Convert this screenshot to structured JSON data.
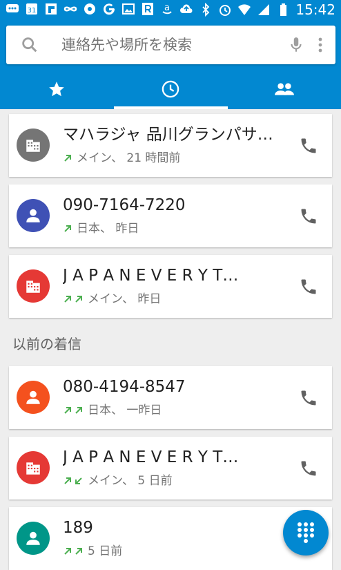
{
  "status_bar": {
    "time": "15:42",
    "icons_left": [
      "chat-icon",
      "calendar-31-icon",
      "flipboard-icon",
      "infinity-icon",
      "at-icon",
      "google-g-icon",
      "image-icon",
      "r-icon",
      "amazon-icon",
      "cloud-upload-icon"
    ],
    "icons_right": [
      "bluetooth-icon",
      "alarm-icon",
      "wifi-icon",
      "signal-icon",
      "battery-icon"
    ],
    "calendar_day": "31"
  },
  "search": {
    "placeholder": "連絡先や場所を検索"
  },
  "tabs": [
    {
      "name": "favorites",
      "icon": "star-icon",
      "selected": false
    },
    {
      "name": "recents",
      "icon": "clock-icon",
      "selected": true
    },
    {
      "name": "contacts",
      "icon": "people-icon",
      "selected": false
    }
  ],
  "section_header": "以前の着信",
  "recents": [
    {
      "name": "マハラジャ 品川グランパサ…",
      "detail": "メイン、 21 時間前",
      "avatar_color": "#757575",
      "avatar_icon": "business-icon",
      "call_types": [
        "outgoing"
      ]
    },
    {
      "name": "090-7164-7220",
      "detail": "日本、 昨日",
      "avatar_color": "#3f51b5",
      "avatar_icon": "person-icon",
      "call_types": [
        "outgoing"
      ]
    },
    {
      "name": "J A P A N  E V E R Y  T…",
      "detail": "メイン、 昨日",
      "avatar_color": "#e53935",
      "avatar_icon": "business-icon",
      "call_types": [
        "outgoing",
        "outgoing"
      ]
    },
    {
      "name": "080-4194-8547",
      "detail": "日本、 一昨日",
      "avatar_color": "#f4511e",
      "avatar_icon": "person-icon",
      "call_types": [
        "outgoing",
        "outgoing"
      ]
    },
    {
      "name": "J A P A N  E V E R Y  T…",
      "detail": "メイン、 5 日前",
      "avatar_color": "#e53935",
      "avatar_icon": "business-icon",
      "call_types": [
        "outgoing",
        "incoming"
      ]
    },
    {
      "name": "189",
      "detail": "5 日前",
      "avatar_color": "#009688",
      "avatar_icon": "person-icon",
      "call_types": [
        "outgoing",
        "outgoing"
      ]
    }
  ],
  "colors": {
    "primary": "#0288d1",
    "call_green": "#4caf50"
  },
  "fab": {
    "icon": "dialpad-icon"
  }
}
